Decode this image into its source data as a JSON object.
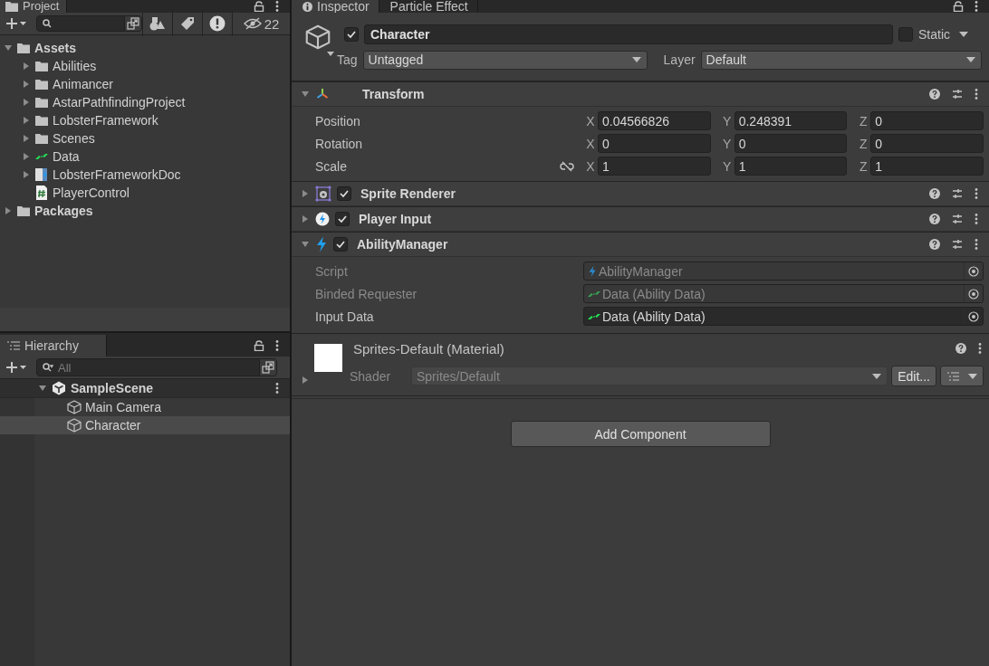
{
  "project_panel": {
    "tab": {
      "label": "Project",
      "selected": true
    },
    "hidden_count": "22",
    "tree": [
      {
        "label": "Assets",
        "kind": "folder",
        "expanded": true,
        "bold": true,
        "children": [
          {
            "label": "Abilities",
            "kind": "folder",
            "expanded": false
          },
          {
            "label": "Animancer",
            "kind": "folder",
            "expanded": false
          },
          {
            "label": "AstarPathfindingProject",
            "kind": "folder",
            "expanded": false
          },
          {
            "label": "LobsterFramework",
            "kind": "folder",
            "expanded": false
          },
          {
            "label": "Scenes",
            "kind": "folder",
            "expanded": false
          },
          {
            "label": "Data",
            "kind": "data",
            "expanded": false
          },
          {
            "label": "LobsterFrameworkDoc",
            "kind": "doc",
            "expanded": false
          },
          {
            "label": "PlayerControl",
            "kind": "script"
          }
        ]
      },
      {
        "label": "Packages",
        "kind": "folder",
        "expanded": false,
        "bold": true
      }
    ]
  },
  "hierarchy_panel": {
    "tab": {
      "label": "Hierarchy",
      "selected": true
    },
    "search": {
      "placeholder": "All"
    },
    "scene": {
      "label": "SampleScene",
      "expanded": true,
      "children": [
        {
          "label": "Main Camera",
          "selected": false
        },
        {
          "label": "Character",
          "selected": true
        }
      ]
    }
  },
  "inspector": {
    "tabs": [
      {
        "label": "Inspector",
        "selected": true
      },
      {
        "label": "Particle Effect",
        "selected": false
      }
    ],
    "object": {
      "active": true,
      "name": "Character",
      "static": false,
      "static_label": "Static",
      "tag_label": "Tag",
      "tag": "Untagged",
      "layer_label": "Layer",
      "layer": "Default"
    },
    "transform": {
      "title": "Transform",
      "expanded": true,
      "rows": [
        {
          "label": "Position",
          "kind": "vector",
          "axes": [
            {
              "axis": "X",
              "value": "0.04566826"
            },
            {
              "axis": "Y",
              "value": "0.248391"
            },
            {
              "axis": "Z",
              "value": "0"
            }
          ]
        },
        {
          "label": "Rotation",
          "kind": "vector",
          "axes": [
            {
              "axis": "X",
              "value": "0"
            },
            {
              "axis": "Y",
              "value": "0"
            },
            {
              "axis": "Z",
              "value": "0"
            }
          ]
        },
        {
          "label": "Scale",
          "kind": "scale",
          "axes": [
            {
              "axis": "X",
              "value": "1"
            },
            {
              "axis": "Y",
              "value": "1"
            },
            {
              "axis": "Z",
              "value": "1"
            }
          ]
        }
      ]
    },
    "components": [
      {
        "title": "Sprite Renderer",
        "kind": "sprite",
        "expanded": false,
        "enabled": true
      },
      {
        "title": "Player Input",
        "kind": "input",
        "expanded": false,
        "enabled": true
      },
      {
        "title": "AbilityManager",
        "kind": "script",
        "expanded": true,
        "enabled": true,
        "fields": [
          {
            "label": "Script",
            "value": "AbilityManager",
            "kind": "script",
            "disabled": true
          },
          {
            "label": "Binded Requester",
            "value": "Data (Ability Data)",
            "kind": "data",
            "disabled": true
          },
          {
            "label": "Input Data",
            "value": "Data (Ability Data)",
            "kind": "data",
            "disabled": false
          }
        ]
      }
    ],
    "material": {
      "title": "Sprites-Default (Material)",
      "expanded": false,
      "shader_label": "Shader",
      "shader": "Sprites/Default",
      "edit_button": "Edit..."
    },
    "add_component": "Add Component"
  }
}
